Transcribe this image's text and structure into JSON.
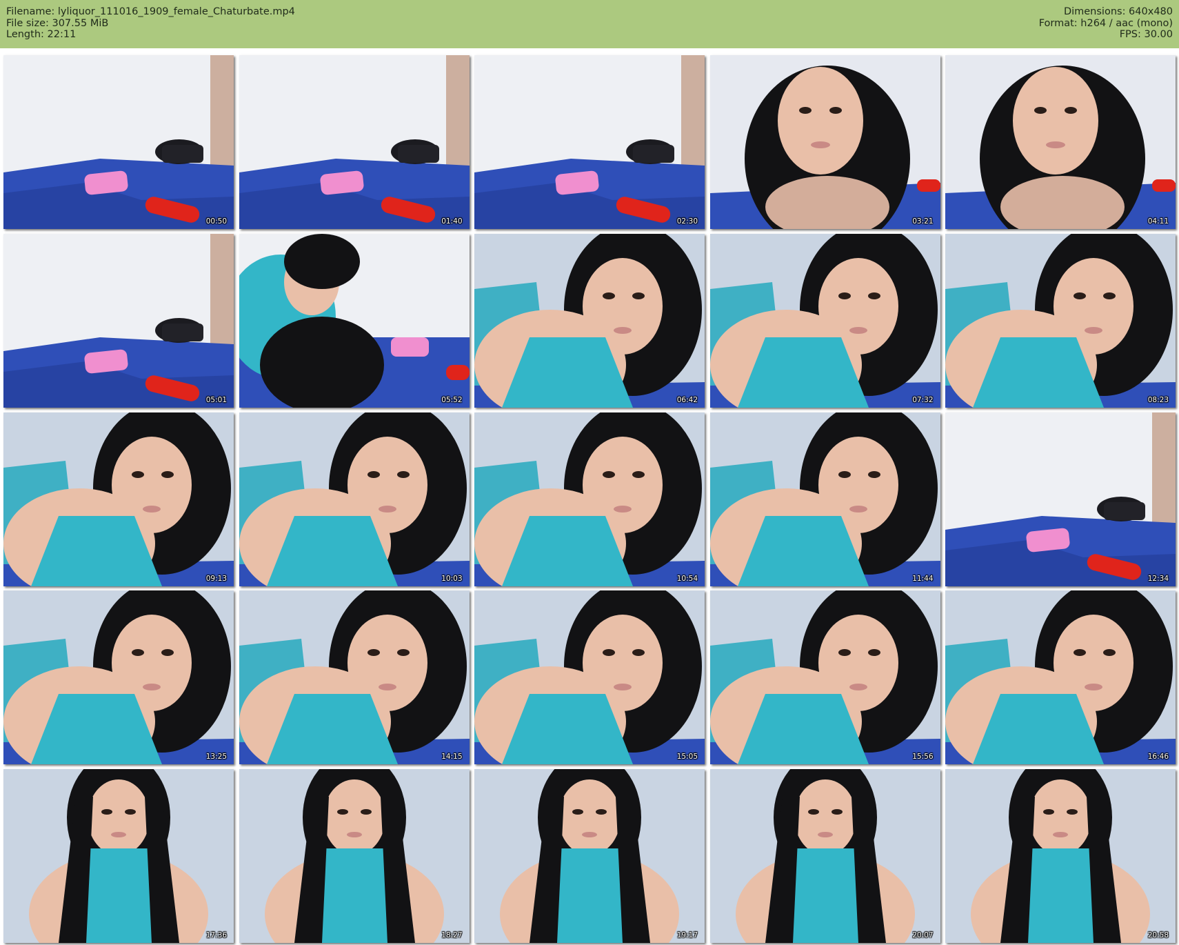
{
  "header": {
    "filename_label": "Filename: lyliquor_111016_1909_female_Chaturbate.mp4",
    "filesize_label": "File size: 307.55 MiB",
    "length_label": "Length: 22:11",
    "dimensions_label": "Dimensions: 640x480",
    "format_label": "Format: h264 / aac (mono)",
    "fps_label": "FPS: 30.00"
  },
  "colors": {
    "header_bg": "#acc97f",
    "wall": "#eef0f4",
    "wall_blue": "#c9d4e2",
    "bedsheet": "#2f4fb8",
    "pillow_pink": "#f08fcf",
    "toy_red": "#e0241b",
    "dress_teal": "#33b6c8",
    "hair": "#121214",
    "skin": "#e9bfa8"
  },
  "thumbnails": [
    {
      "timestamp": "00:50",
      "scene": "room"
    },
    {
      "timestamp": "01:40",
      "scene": "room"
    },
    {
      "timestamp": "02:30",
      "scene": "room"
    },
    {
      "timestamp": "03:21",
      "scene": "closeup"
    },
    {
      "timestamp": "04:11",
      "scene": "closeup"
    },
    {
      "timestamp": "05:01",
      "scene": "room"
    },
    {
      "timestamp": "05:52",
      "scene": "side"
    },
    {
      "timestamp": "06:42",
      "scene": "lean"
    },
    {
      "timestamp": "07:32",
      "scene": "lean"
    },
    {
      "timestamp": "08:23",
      "scene": "lean"
    },
    {
      "timestamp": "09:13",
      "scene": "lean"
    },
    {
      "timestamp": "10:03",
      "scene": "lean"
    },
    {
      "timestamp": "10:54",
      "scene": "lean"
    },
    {
      "timestamp": "11:44",
      "scene": "lean"
    },
    {
      "timestamp": "12:34",
      "scene": "room"
    },
    {
      "timestamp": "13:25",
      "scene": "lean"
    },
    {
      "timestamp": "14:15",
      "scene": "lean"
    },
    {
      "timestamp": "15:05",
      "scene": "lean"
    },
    {
      "timestamp": "15:56",
      "scene": "lean"
    },
    {
      "timestamp": "16:46",
      "scene": "lean"
    },
    {
      "timestamp": "17:36",
      "scene": "seated"
    },
    {
      "timestamp": "18:27",
      "scene": "seated"
    },
    {
      "timestamp": "19:17",
      "scene": "seated"
    },
    {
      "timestamp": "20:07",
      "scene": "seated"
    },
    {
      "timestamp": "20:58",
      "scene": "seated"
    }
  ]
}
